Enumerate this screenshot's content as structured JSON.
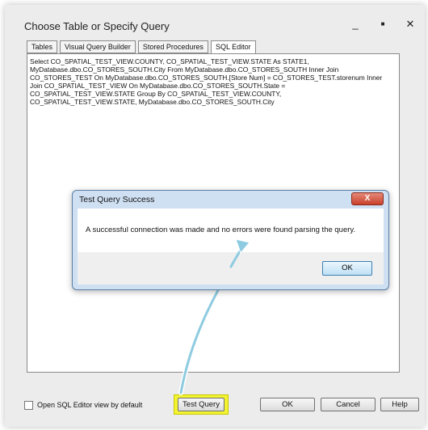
{
  "window": {
    "title": "Choose Table or Specify Query",
    "minimize_glyph": "_",
    "maximize_glyph": "■",
    "close_glyph": "✕"
  },
  "tabs": [
    {
      "label": "Tables"
    },
    {
      "label": "Visual Query Builder"
    },
    {
      "label": "Stored Procedures"
    },
    {
      "label": "SQL Editor"
    }
  ],
  "editor": {
    "sql": "Select CO_SPATIAL_TEST_VIEW.COUNTY, CO_SPATIAL_TEST_VIEW.STATE As STATE1,\nMyDatabase.dbo.CO_STORES_SOUTH.City From MyDatabase.dbo.CO_STORES_SOUTH Inner Join\nCO_STORES_TEST On MyDatabase.dbo.CO_STORES_SOUTH.[Store Num] = CO_STORES_TEST.storenum Inner\nJoin CO_SPATIAL_TEST_VIEW On MyDatabase.dbo.CO_STORES_SOUTH.State =\nCO_SPATIAL_TEST_VIEW.STATE Group By CO_SPATIAL_TEST_VIEW.COUNTY,\nCO_SPATIAL_TEST_VIEW.STATE, MyDatabase.dbo.CO_STORES_SOUTH.City"
  },
  "footer": {
    "checkbox_label": "Open SQL Editor view by default",
    "test_query": "Test Query",
    "ok": "OK",
    "cancel": "Cancel",
    "help": "Help"
  },
  "dialog": {
    "title": "Test Query Success",
    "close_glyph": "X",
    "message": "A successful connection was made and no errors were found parsing the query.",
    "ok": "OK"
  },
  "colors": {
    "highlight": "#f3f331",
    "arrow": "#8ecbe0"
  }
}
